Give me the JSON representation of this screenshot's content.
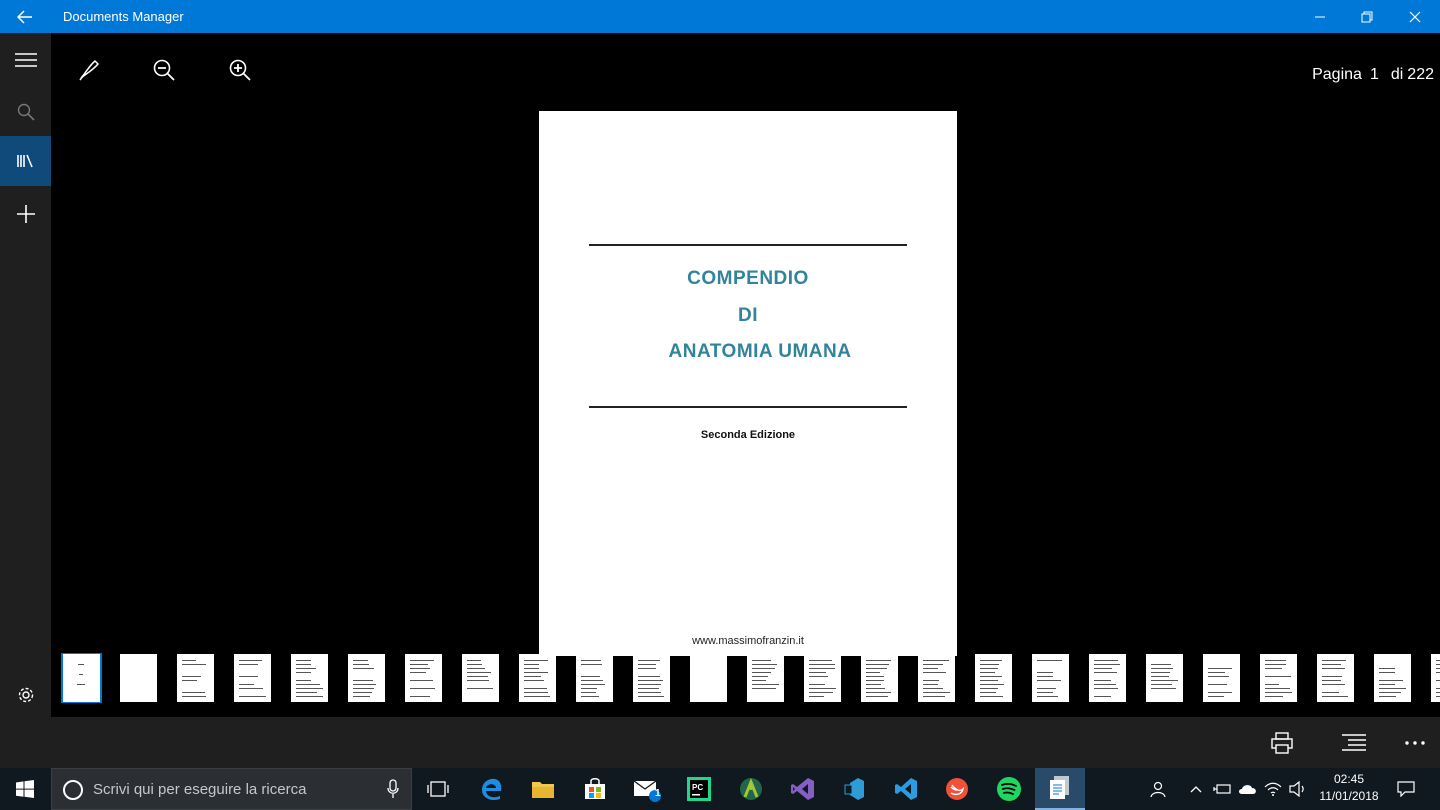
{
  "window": {
    "title": "Documents Manager"
  },
  "toolbar": {
    "page_prefix": "Pagina",
    "page_current": "1",
    "page_of": "di",
    "page_total": "222"
  },
  "document": {
    "title_line1": "COMPENDIO",
    "title_line2": "DI",
    "title_line3": "ANATOMIA UMANA",
    "edition": "Seconda Edizione",
    "url": "www.massimofranzin.it"
  },
  "thumbnails": {
    "count_visible": 25,
    "selected_index": 0
  },
  "taskbar": {
    "search_placeholder": "Scrivi qui per eseguire la ricerca",
    "mail_badge": "1",
    "time": "02:45",
    "date": "11/01/2018"
  },
  "colors": {
    "accent": "#0078d7",
    "title_teal": "#31849b",
    "nav_bg": "#1f1f1f"
  }
}
